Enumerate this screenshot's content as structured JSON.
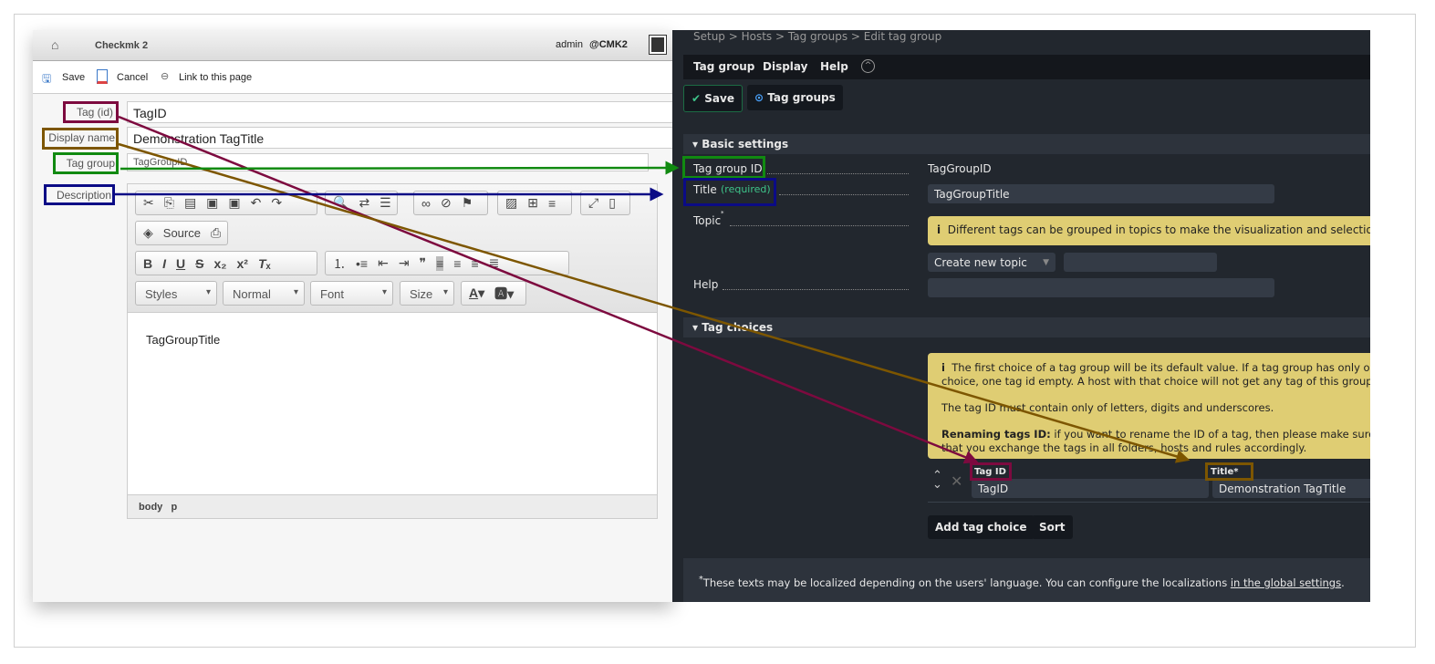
{
  "left": {
    "breadcrumb": "Checkmk 2",
    "user": "admin",
    "site": "@CMK2",
    "actions": {
      "save": "Save",
      "cancel": "Cancel",
      "link": "Link to this page"
    },
    "fields": {
      "tag_id_label": "Tag (id)",
      "tag_id_value": "TagID",
      "display_name_label": "Display name",
      "display_name_value": "Demonstration TagTitle",
      "tag_group_label": "Tag group",
      "tag_group_value": "TagGroupID",
      "description_label": "Description"
    },
    "editor": {
      "source": "Source",
      "styles": "Styles",
      "format": "Normal",
      "font": "Font",
      "size": "Size",
      "content": "TagGroupTitle",
      "path": [
        "body",
        "p"
      ]
    }
  },
  "right": {
    "breadcrumb": "Setup > Hosts > Tag groups > Edit tag group",
    "menu": [
      "Tag group",
      "Display",
      "Help"
    ],
    "save": "Save",
    "tag_groups": "Tag groups",
    "basic_settings": "Basic settings",
    "tag_group_id_label": "Tag group ID",
    "tag_group_id_value": "TagGroupID",
    "title_label": "Title",
    "title_required": "(required)",
    "title_value": "TagGroupTitle",
    "topic_label": "Topic",
    "topic_info": "Different tags can be grouped in topics to make the visualization and selections",
    "topic_select": "Create new topic",
    "help_label": "Help",
    "tag_choices": "Tag choices",
    "info1": "The first choice of a tag group will be its default value. If a tag group has only one choice, one tag id empty. A host with that choice will not get any tag of this group.",
    "info2": "The tag ID must contain only of letters, digits and underscores.",
    "info3_bold": "Renaming tags ID:",
    "info3": " if you want to rename the ID of a tag, then please make sure that you exchange the tags in all folders, hosts and rules accordingly.",
    "col_tag_id": "Tag ID",
    "col_title": "Title*",
    "row_tag_id": "TagID",
    "row_title": "Demonstration TagTitle",
    "add_choice": "Add tag choice",
    "sort": "Sort",
    "footer": "These texts may be localized depending on the users' language. You can configure the localizations ",
    "footer_link": "in the global settings",
    "footer_end": "."
  },
  "colors": {
    "maroon": "#7d0a3f",
    "brown": "#7d5600",
    "green": "#118a11",
    "navy": "#0b0b86",
    "dark_bg": "#22272e",
    "info_yellow": "#dfcd73"
  }
}
